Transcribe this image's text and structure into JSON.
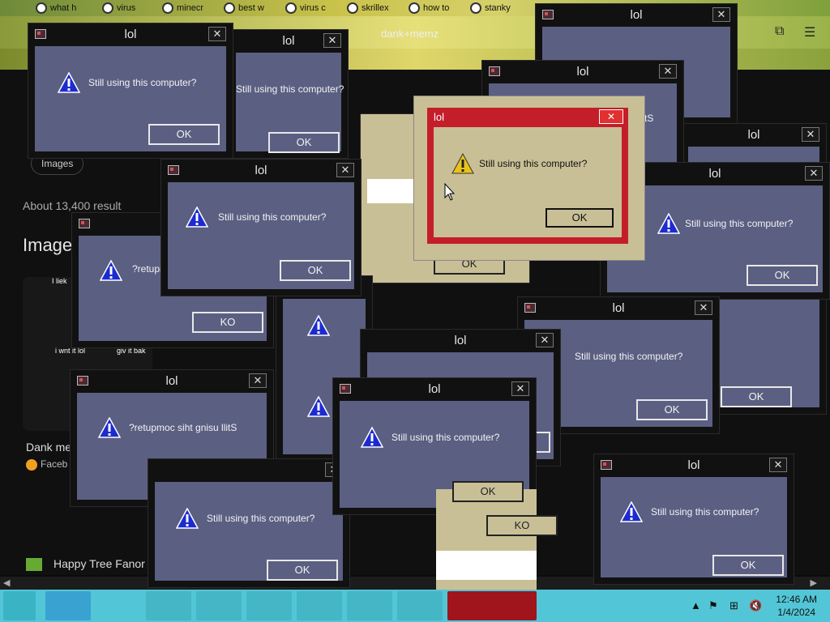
{
  "browser": {
    "tabs": [
      "what h",
      "virus",
      "minecr",
      "best w",
      "virus c",
      "skrillex",
      "how to",
      "stanky"
    ],
    "address_fragment": "dank+memz"
  },
  "page": {
    "results_count": "About 13,400 result",
    "images_heading": "Image",
    "chip_label": "Images",
    "meme_caption_top": "I liek",
    "meme_caption_a": "i wnt it lol",
    "meme_caption_b": "giv it bak",
    "dank_label": "Dank me",
    "facebook_label": "Faceb",
    "tree_label": "Happy Tree Fanor"
  },
  "dialog": {
    "title": "lol",
    "message": "Still using this computer?",
    "message_reversed": "?retupmoc siht gnisu llitS",
    "ok": "OK",
    "ok_reversed": "KO"
  },
  "clock": {
    "time": "12:46 AM",
    "date": "1/4/2024"
  },
  "colors": {
    "dialog_body": "#5b5f82",
    "focused_frame": "#c41e2a",
    "taskbar": "#52c6d6"
  }
}
